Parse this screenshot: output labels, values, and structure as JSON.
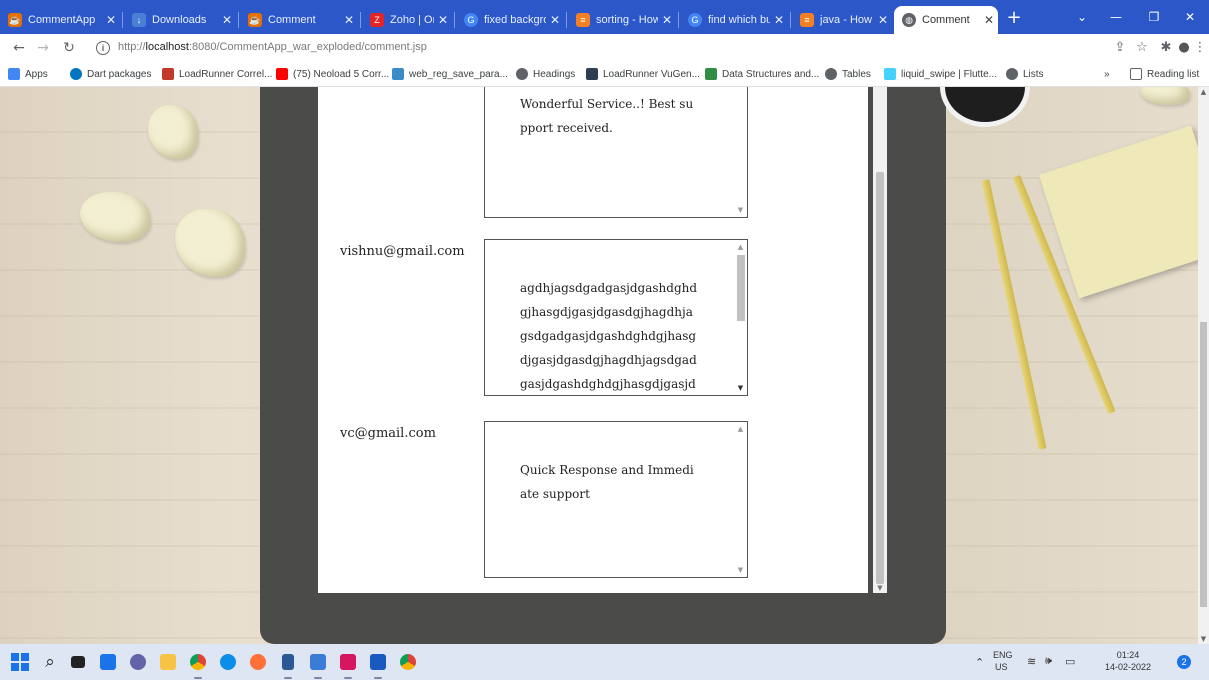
{
  "browser": {
    "tabs": [
      {
        "label": "CommentApp",
        "icon": "java-icon",
        "color": "#e76f00",
        "active": false
      },
      {
        "label": "Downloads",
        "icon": "download-icon",
        "color": "#4a7fd8",
        "active": false
      },
      {
        "label": "Comment",
        "icon": "java-icon",
        "color": "#e76f00",
        "active": false
      },
      {
        "label": "Zoho | Online",
        "icon": "zoho-icon",
        "color": "#e42527",
        "active": false
      },
      {
        "label": "fixed backgro",
        "icon": "google-icon",
        "color": "#4285f4",
        "active": false
      },
      {
        "label": "sorting - How",
        "icon": "stackoverflow-icon",
        "color": "#f48024",
        "active": false
      },
      {
        "label": "find which but",
        "icon": "google-icon",
        "color": "#4285f4",
        "active": false
      },
      {
        "label": "java - How to",
        "icon": "stackoverflow-icon",
        "color": "#f48024",
        "active": false
      },
      {
        "label": "Comment",
        "icon": "globe-icon",
        "color": "#5f6368",
        "active": true
      }
    ],
    "new_tab_label": "+",
    "url_host": "localhost",
    "url_prefix": "http://",
    "url_rest": ":8080/CommentApp_war_exploded/comment.jsp",
    "bookmarks": [
      {
        "label": "Apps",
        "icon": "apps-grid-icon",
        "color": "#4285f4"
      },
      {
        "label": "Dart packages",
        "icon": "dart-icon",
        "color": "#0175c2"
      },
      {
        "label": "LoadRunner Correl...",
        "icon": "loadrunner-icon",
        "color": "#c0392b"
      },
      {
        "label": "(75) Neoload 5 Corr...",
        "icon": "youtube-icon",
        "color": "#ff0000"
      },
      {
        "label": "web_reg_save_para...",
        "icon": "site-icon",
        "color": "#3a8bc8"
      },
      {
        "label": "Headings",
        "icon": "globe-icon",
        "color": "#5f6368"
      },
      {
        "label": "LoadRunner VuGen...",
        "icon": "site-icon",
        "color": "#2c3e50"
      },
      {
        "label": "Data Structures and...",
        "icon": "gfg-icon",
        "color": "#2f8d46"
      },
      {
        "label": "Tables",
        "icon": "globe-icon",
        "color": "#5f6368"
      },
      {
        "label": "liquid_swipe | Flutte...",
        "icon": "flutter-icon",
        "color": "#44d1fd"
      },
      {
        "label": "Lists",
        "icon": "globe-icon",
        "color": "#5f6368"
      }
    ],
    "more_bookmarks": "»",
    "reading_list": "Reading list"
  },
  "comments": [
    {
      "email": "",
      "text": "Wonderful Service..! Best support received."
    },
    {
      "email": "vishnu@gmail.com",
      "text": "agdhjagsdgadgasjdgashdghdgjhasgdjgasjdgasdgjhagdhjagsdgadgasjdgashdghdgjhasgdjgasjdgasdgjhagdhjagsdgadgasjdgashdghdgjhasgdjgasjdgasdgjh"
    },
    {
      "email": "vc@gmail.com",
      "text": "Quick Response and Immediate support"
    }
  ],
  "taskbar": {
    "lang_top": "ENG",
    "lang_bottom": "US",
    "time": "01:24",
    "date": "14-02-2022",
    "notification_count": "2"
  }
}
